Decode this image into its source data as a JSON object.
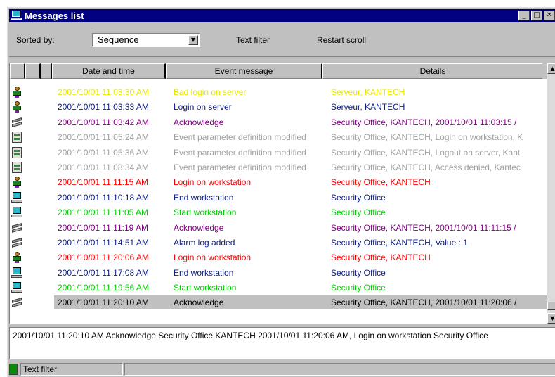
{
  "window": {
    "title": "Messages list",
    "buttons": [
      "minimize",
      "maximize",
      "close"
    ]
  },
  "toolbar": {
    "sorted_by_label": "Sorted by:",
    "sort_value": "Sequence",
    "text_filter_label": "Text filter",
    "restart_scroll_label": "Restart scroll"
  },
  "columns": {
    "date": "Date and time",
    "event": "Event message",
    "details": "Details"
  },
  "colors": {
    "yellow": "#e8e800",
    "navy": "#102080",
    "purple": "#800080",
    "gray": "#a0a0a0",
    "red": "#ff0000",
    "green": "#00d000",
    "selected": "#000000"
  },
  "rows": [
    {
      "icon": "person-icon",
      "color": "yellow",
      "date": "2001/10/01 11:03:30 AM",
      "event": "Bad login on server",
      "details": "Serveur, KANTECH"
    },
    {
      "icon": "person-icon",
      "color": "navy",
      "date": "2001/10/01 11:03:33 AM",
      "event": "Login on server",
      "details": "Serveur, KANTECH"
    },
    {
      "icon": "acknowledge-icon",
      "color": "purple",
      "date": "2001/10/01 11:03:42 AM",
      "event": "Acknowledge",
      "details": "Security Office, KANTECH, 2001/10/01 11:03:15 /"
    },
    {
      "icon": "document-icon",
      "color": "gray",
      "date": "2001/10/01 11:05:24 AM",
      "event": "Event parameter definition modified",
      "details": "Security Office, KANTECH, Login on workstation, K"
    },
    {
      "icon": "document-icon",
      "color": "gray",
      "date": "2001/10/01 11:05:36 AM",
      "event": "Event parameter definition modified",
      "details": "Security Office, KANTECH, Logout on server, Kant"
    },
    {
      "icon": "document-icon",
      "color": "gray",
      "date": "2001/10/01 11:08:34 AM",
      "event": "Event parameter definition modified",
      "details": "Security Office, KANTECH, Access denied, Kantec"
    },
    {
      "icon": "person-icon",
      "color": "red",
      "date": "2001/10/01 11:11:15 AM",
      "event": "Login on workstation",
      "details": "Security Office, KANTECH"
    },
    {
      "icon": "computer-icon",
      "color": "navy",
      "date": "2001/10/01 11:10:18 AM",
      "event": "End workstation",
      "details": "Security Office"
    },
    {
      "icon": "computer-icon",
      "color": "green",
      "date": "2001/10/01 11:11:05 AM",
      "event": "Start workstation",
      "details": "Security Office"
    },
    {
      "icon": "acknowledge-icon",
      "color": "purple",
      "date": "2001/10/01 11:11:19 AM",
      "event": "Acknowledge",
      "details": "Security Office, KANTECH, 2001/10/01 11:11:15 /"
    },
    {
      "icon": "acknowledge-icon",
      "color": "navy",
      "date": "2001/10/01 11:14:51 AM",
      "event": "Alarm log added",
      "details": "Security Office, KANTECH, Value : 1"
    },
    {
      "icon": "person-icon",
      "color": "red",
      "date": "2001/10/01 11:20:06 AM",
      "event": "Login on workstation",
      "details": "Security Office, KANTECH"
    },
    {
      "icon": "computer-icon",
      "color": "navy",
      "date": "2001/10/01 11:17:08 AM",
      "event": "End workstation",
      "details": "Security Office"
    },
    {
      "icon": "computer-icon",
      "color": "green",
      "date": "2001/10/01 11:19:56 AM",
      "event": "Start workstation",
      "details": "Security Office"
    },
    {
      "icon": "acknowledge-icon",
      "color": "selected",
      "selected": true,
      "date": "2001/10/01 11:20:10 AM",
      "event": "Acknowledge",
      "details": "Security Office, KANTECH, 2001/10/01 11:20:06 /"
    }
  ],
  "detail_text": "2001/10/01 11:20:10 AM  Acknowledge  Security Office  KANTECH  2001/10/01 11:20:06 AM, Login on workstation  Security Office",
  "status": {
    "text": "Text filter"
  }
}
